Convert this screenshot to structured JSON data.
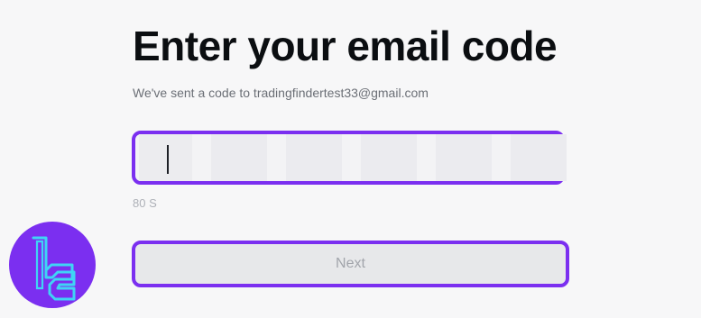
{
  "heading": {
    "title": "Enter your email code",
    "subtitle": "We've sent a code to tradingfindertest33@gmail.com"
  },
  "code_input": {
    "cell_count": 6,
    "values": [
      "",
      "",
      "",
      "",
      "",
      ""
    ],
    "focused_cell": 1
  },
  "timer": {
    "text": "80 S"
  },
  "next_button": {
    "label": "Next",
    "disabled": true
  },
  "colors": {
    "accent": "#7b2ff0",
    "title": "#0b0e11",
    "muted_text": "#aeb1b8",
    "logo_bg": "#7b2ff0",
    "logo_mark": "#3fd4f5"
  },
  "logo": {
    "icon": "tradingfinder-logo-icon"
  }
}
